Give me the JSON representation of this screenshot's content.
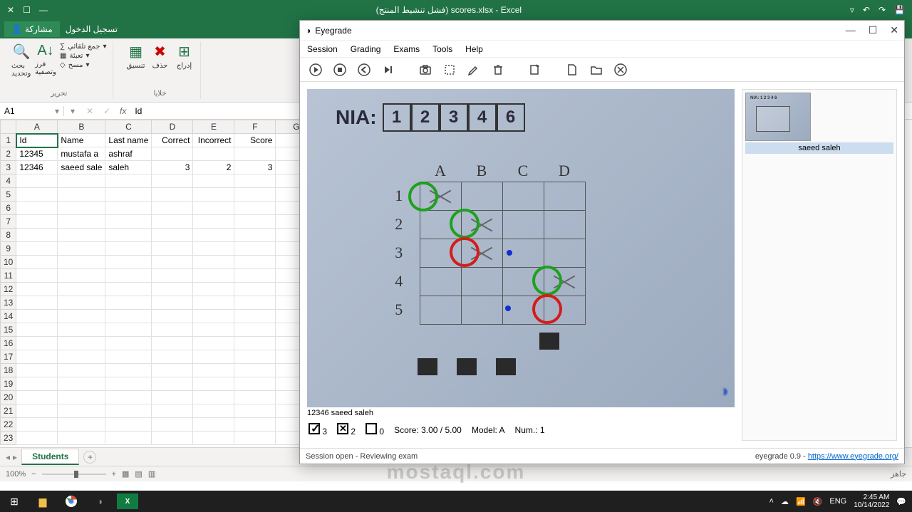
{
  "excel": {
    "title": "(فشل تنشيط المنتج) scores.xlsx - Excel",
    "share": "مشاركة",
    "signin": "تسجيل الدخول",
    "ribbon": {
      "search_label": "بحث وتحديد",
      "sort_label": "فرز وتصفية",
      "autosum": "جمع تلقائي",
      "fill": "تعبئة",
      "clear": "مسح",
      "edit_group": "تحرير",
      "format_label": "تنسيق",
      "delete_label": "حذف",
      "insert_label": "إدراج",
      "cells_group": "خلايا"
    },
    "namebox": "A1",
    "fx": "fx",
    "formula": "Id",
    "cols": [
      "A",
      "B",
      "C",
      "D",
      "E",
      "F",
      "G"
    ],
    "rows_count": 23,
    "headers": [
      "Id",
      "Name",
      "Last name",
      "Correct",
      "Incorrect",
      "Score"
    ],
    "data": [
      {
        "id": "12345",
        "name": "mustafa a",
        "last": "ashraf",
        "correct": "",
        "incorrect": "",
        "score": ""
      },
      {
        "id": "12346",
        "name": "saeed sale",
        "last": "saleh",
        "correct": "3",
        "incorrect": "2",
        "score": "3"
      }
    ],
    "sheet_tab": "Students",
    "ready": "جاهز",
    "zoom": "100%"
  },
  "eyegrade": {
    "title": "Eyegrade",
    "menu": [
      "Session",
      "Grading",
      "Exams",
      "Tools",
      "Help"
    ],
    "nia_label": "NIA:",
    "nia_digits": [
      "1",
      "2",
      "3",
      "4",
      "6"
    ],
    "grid_cols": [
      "A",
      "B",
      "C",
      "D"
    ],
    "grid_rows": [
      "1",
      "2",
      "3",
      "4",
      "5"
    ],
    "caption": "12346 saeed saleh",
    "correct_count": "3",
    "incorrect_count": "2",
    "blank_count": "0",
    "score_text": "Score: 3.00 / 5.00",
    "model_text": "Model: A",
    "num_text": "Num.: 1",
    "thumb_label": "saeed saleh",
    "status_left": "Session open - Reviewing exam",
    "status_right_pre": "eyegrade 0.9 - ",
    "status_link": "https://www.eyegrade.org/"
  },
  "taskbar": {
    "lang": "ENG",
    "time": "2:45 AM",
    "date": "10/14/2022"
  },
  "watermark": "mostaql.com"
}
